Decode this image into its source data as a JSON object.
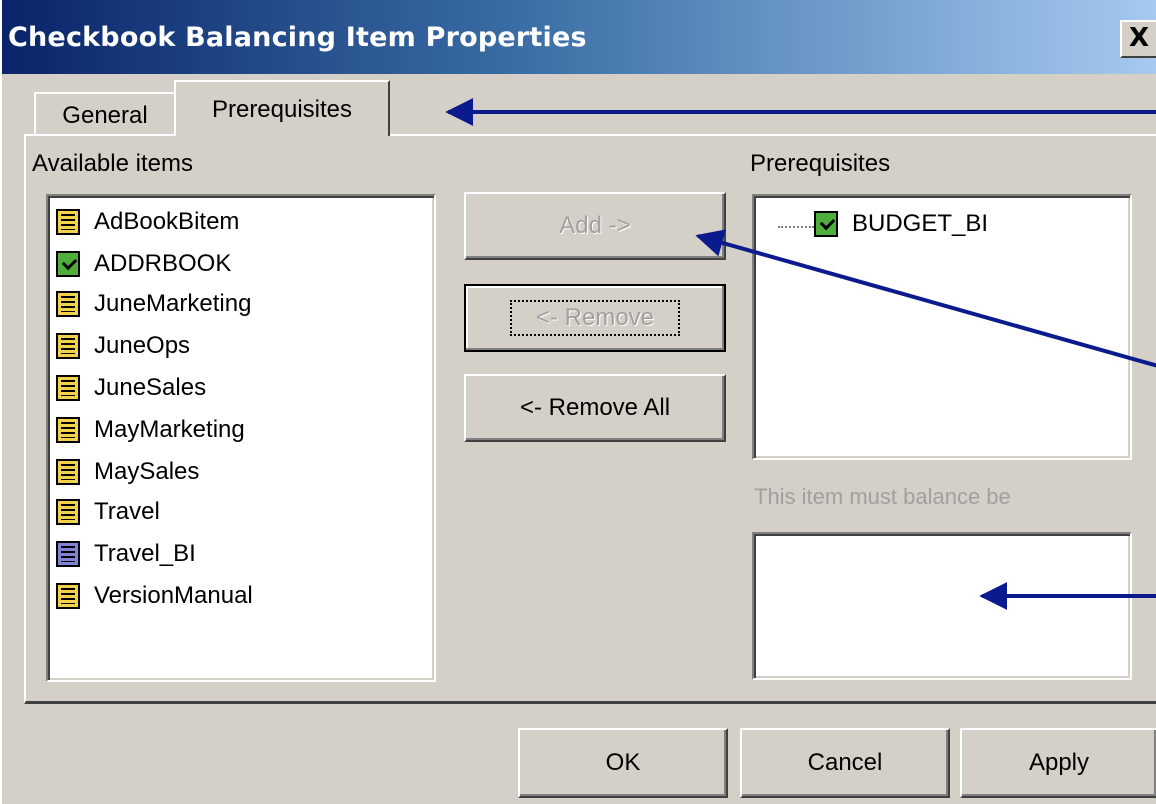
{
  "window": {
    "title": "Checkbook Balancing Item Properties",
    "close_label": "X"
  },
  "tabs": [
    {
      "label": "General",
      "active": false
    },
    {
      "label": "Prerequisites",
      "active": true
    }
  ],
  "available": {
    "label": "Available items",
    "items": [
      {
        "label": "AdBookBitem",
        "icon": "report-icon"
      },
      {
        "label": "ADDRBOOK",
        "icon": "checked-report-icon"
      },
      {
        "label": "JuneMarketing",
        "icon": "report-icon"
      },
      {
        "label": "JuneOps",
        "icon": "report-icon"
      },
      {
        "label": "JuneSales",
        "icon": "report-icon"
      },
      {
        "label": "MayMarketing",
        "icon": "report-icon"
      },
      {
        "label": "MaySales",
        "icon": "report-icon"
      },
      {
        "label": "Travel",
        "icon": "report-icon"
      },
      {
        "label": "Travel_BI",
        "icon": "balancing-item-icon"
      },
      {
        "label": "VersionManual",
        "icon": "report-icon"
      }
    ]
  },
  "buttons": {
    "add": "Add ->",
    "remove": "<- Remove",
    "remove_all": "<- Remove All",
    "ok": "OK",
    "cancel": "Cancel",
    "apply": "Apply"
  },
  "prerequisites": {
    "label": "Prerequisites",
    "items": [
      {
        "label": "BUDGET_BI",
        "icon": "checked-report-icon"
      }
    ]
  },
  "balance": {
    "label": "This item must balance be"
  },
  "colors": {
    "dialog_bg": "#d4d0c8",
    "title_gradient_start": "#0a246a",
    "title_gradient_end": "#a6caf0",
    "annotation_arrow": "#0b1a8c",
    "disabled_text": "#a0a0a0"
  }
}
